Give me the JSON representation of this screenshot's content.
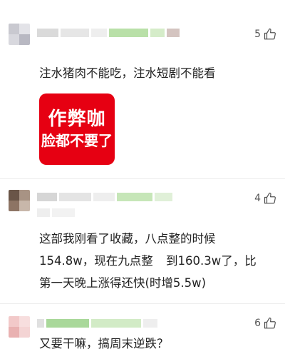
{
  "comments": [
    {
      "like_count": "5",
      "text": "注水猪肉不能吃，注水短剧不能看",
      "sticker": {
        "line1": "作弊咖",
        "line2": "脸都不要了",
        "color": "#e60012"
      }
    },
    {
      "like_count": "4",
      "lines": [
        "这部我刚看了收藏，八点整的时候",
        "154.8w，现在九点整",
        "到160.3w了，比",
        "第一天晚上涨得还快(时增5.5w)"
      ]
    },
    {
      "like_count": "6",
      "text": "又要干嘛，搞周末逆跌？"
    }
  ],
  "colors": {
    "accent_green": "#b9e0a8",
    "blur_gray": "#d9d9d9",
    "like_gray": "#555555"
  }
}
